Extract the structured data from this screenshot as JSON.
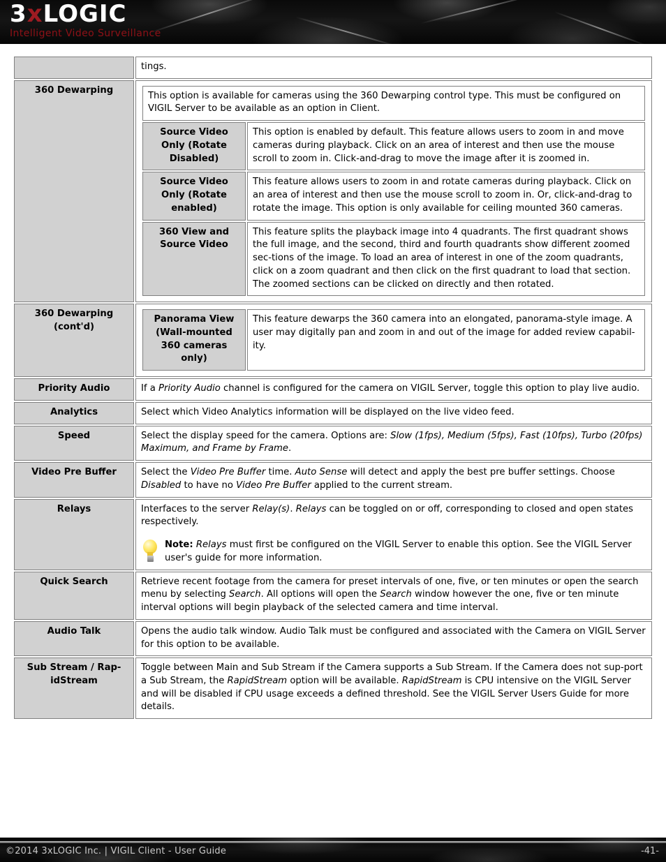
{
  "header": {
    "logo_prefix": "3",
    "logo_x": "x",
    "logo_suffix": "LOGIC",
    "tagline": "Intelligent Video Surveillance",
    "accent_red": "#9e1b22",
    "background": "#0a0a0a"
  },
  "footer": {
    "copyright": "©2014 3xLOGIC Inc.  |  VIGIL Client - User Guide",
    "page_number": "-41-"
  },
  "table": {
    "rows": [
      {
        "label": "",
        "desc": "tings."
      },
      {
        "label": "360 Dewarping",
        "intro": "This option is available for cameras using the 360 Dewarping control type.  This must be configured on VIGIL Server to be available as an option in Client.",
        "subrows": [
          {
            "sublabel": "Source Video Only (Rotate Disabled)",
            "desc": "This option is enabled by default. This feature allows users to zoom in and move cameras during playback. Click on an area of interest and then use the mouse scroll to zoom in. Click-and-drag to move the image after it is zoomed in."
          },
          {
            "sublabel": "Source Video Only (Rotate enabled)",
            "desc": "This feature allows users to zoom in and rotate cameras during playback. Click on an area of interest and then use the mouse scroll to zoom in. Or, click-and-drag to rotate the image. This option is only available for ceiling mounted 360 cameras."
          },
          {
            "sublabel": "360 View and Source Video",
            "desc": "This feature splits the playback image into 4 quadrants. The first quadrant shows the full image, and the second, third and fourth quadrants show different zoomed sec-tions of the image. To load an area of interest in one of the zoom quadrants, click on a zoom quadrant and then click on the first quadrant to load that section. The zoomed sections can be clicked on directly and then rotated."
          }
        ]
      },
      {
        "label": "360 Dewarping (cont'd)",
        "sublabel": "Panorama View (Wall-mounted 360 cameras only)",
        "desc": "This feature dewarps the 360 camera into an elongated, panorama-style image. A user may digitally pan and zoom in and out of the image for added review capabil-ity."
      },
      {
        "label": "Priority Audio",
        "desc_parts": [
          {
            "t": "If a ",
            "i": false
          },
          {
            "t": "Priority Audio",
            "i": true
          },
          {
            "t": " channel is configured for the camera on VIGIL Server, toggle this option to play live audio.",
            "i": false
          }
        ]
      },
      {
        "label": "Analytics",
        "desc": "Select which Video Analytics information will be displayed on the live video feed."
      },
      {
        "label": "Speed",
        "desc_parts": [
          {
            "t": "Select the display speed for the camera.  Options are: ",
            "i": false
          },
          {
            "t": "Slow (1fps), Medium (5fps), Fast (10fps), Turbo (20fps) Maximum, and Frame by Frame",
            "i": true
          },
          {
            "t": ".",
            "i": false
          }
        ]
      },
      {
        "label": "Video Pre Buffer",
        "desc_parts": [
          {
            "t": "Select the ",
            "i": false
          },
          {
            "t": "Video Pre Buffer",
            "i": true
          },
          {
            "t": " time. ",
            "i": false
          },
          {
            "t": "Auto Sense",
            "i": true
          },
          {
            "t": " will detect and apply the best pre buffer settings. Choose ",
            "i": false
          },
          {
            "t": "Disabled",
            "i": true
          },
          {
            "t": " to have no ",
            "i": false
          },
          {
            "t": "Video Pre Buffer",
            "i": true
          },
          {
            "t": " applied to the current stream.",
            "i": false
          }
        ]
      },
      {
        "label": "Relays",
        "desc_parts": [
          {
            "t": "Interfaces to the server ",
            "i": false
          },
          {
            "t": "Relay(s)",
            "i": true
          },
          {
            "t": ".  ",
            "i": false
          },
          {
            "t": "Relays",
            "i": true
          },
          {
            "t": " can be toggled on or off, corresponding to closed and open states respectively.",
            "i": false
          }
        ],
        "note_icon": "lightbulb-icon",
        "note_label": "Note:",
        "note_parts": [
          {
            "t": " ",
            "i": false
          },
          {
            "t": "Relays",
            "i": true
          },
          {
            "t": " must first be configured on the VIGIL Server to enable this option. See the VIGIL Server user's guide for more information.",
            "i": false
          }
        ]
      },
      {
        "label": "Quick Search",
        "desc_parts": [
          {
            "t": "Retrieve recent footage from the camera for preset intervals of one, five, or ten minutes or open the search menu by selecting ",
            "i": false
          },
          {
            "t": "Search",
            "i": true
          },
          {
            "t": ". All options will open the ",
            "i": false
          },
          {
            "t": "Search",
            "i": true
          },
          {
            "t": " window however the one, five or ten minute interval options will begin playback of the selected camera and time interval.",
            "i": false
          }
        ]
      },
      {
        "label": "Audio Talk",
        "desc": "Opens the audio talk window.  Audio Talk must be configured and associated with the Camera on VIGIL Server for this option to be available."
      },
      {
        "label": "Sub Stream / Rap-idStream",
        "desc_parts": [
          {
            "t": "Toggle between Main and Sub Stream if the Camera supports a Sub Stream.  If the Camera does not sup-port a Sub Stream, the ",
            "i": false
          },
          {
            "t": "RapidStream",
            "i": true
          },
          {
            "t": " option will be available.  ",
            "i": false
          },
          {
            "t": "RapidStream",
            "i": true
          },
          {
            "t": " is CPU intensive on the VIGIL Server and will be disabled if CPU usage exceeds a defined threshold.  See the VIGIL Server Users Guide for more details.",
            "i": false
          }
        ]
      }
    ]
  }
}
